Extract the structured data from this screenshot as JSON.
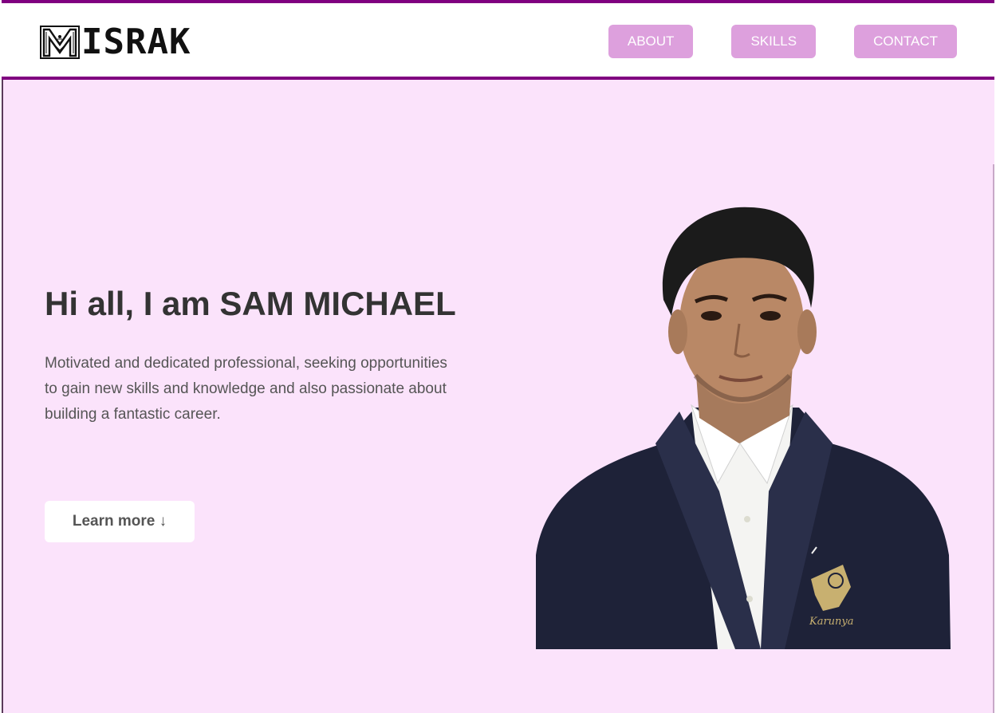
{
  "logo": {
    "text": "ISRAK",
    "initial": "M"
  },
  "nav": {
    "about": "ABOUT",
    "skills": "SKILLS",
    "contact": "CONTACT"
  },
  "hero": {
    "title": "Hi all, I am SAM MICHAEL",
    "description": "Motivated and dedicated professional, seeking opportunities to gain new skills and knowledge and also passionate about building a fantastic career.",
    "cta": "Learn more ↓"
  },
  "portrait": {
    "badge_text": "Karunya"
  },
  "colors": {
    "accent": "#800080",
    "nav_button": "#dda0dd",
    "hero_background": "#fbe3fb"
  }
}
